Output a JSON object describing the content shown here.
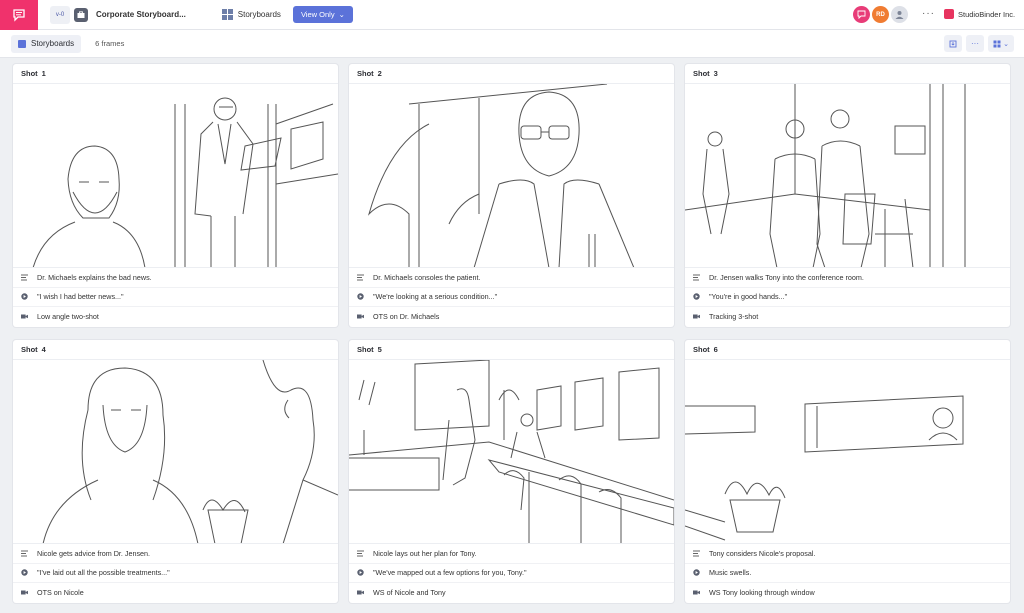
{
  "header": {
    "version": "v-0",
    "project_title": "Corporate Storyboard...",
    "nav_label": "Storyboards",
    "view_button": "View Only",
    "avatars": [
      {
        "initials": "",
        "color": "#e83c78"
      },
      {
        "initials": "RD",
        "color": "#f07c32"
      },
      {
        "initials": "",
        "color": "#c9cbd2"
      }
    ],
    "org_name": "StudioBinder Inc.",
    "brand_color": "#f0326c",
    "accent_color": "#5b72d9"
  },
  "subbar": {
    "tab_label": "Storyboards",
    "frame_count": "6 frames"
  },
  "shots": [
    {
      "label": "Shot",
      "number": "1",
      "description": "Dr. Michaels explains the bad news.",
      "dialogue": "\"I wish I had better news...\"",
      "camera": "Low angle two-shot"
    },
    {
      "label": "Shot",
      "number": "2",
      "description": "Dr. Michaels consoles the patient.",
      "dialogue": "\"We're looking at a serious condition...\"",
      "camera": "OTS on Dr. Michaels"
    },
    {
      "label": "Shot",
      "number": "3",
      "description": "Dr. Jensen walks Tony into the conference room.",
      "dialogue": "\"You're in good hands...\"",
      "camera": "Tracking 3-shot"
    },
    {
      "label": "Shot",
      "number": "4",
      "description": "Nicole gets advice from Dr. Jensen.",
      "dialogue": "\"I've laid out all the possible treatments...\"",
      "camera": "OTS on Nicole"
    },
    {
      "label": "Shot",
      "number": "5",
      "description": "Nicole lays out her plan for Tony.",
      "dialogue": "\"We've mapped out a few options for you, Tony.\"",
      "camera": "WS of Nicole and Tony"
    },
    {
      "label": "Shot",
      "number": "6",
      "description": "Tony considers Nicole's proposal.",
      "dialogue": "Music swells.",
      "camera": "WS Tony looking through window"
    }
  ]
}
